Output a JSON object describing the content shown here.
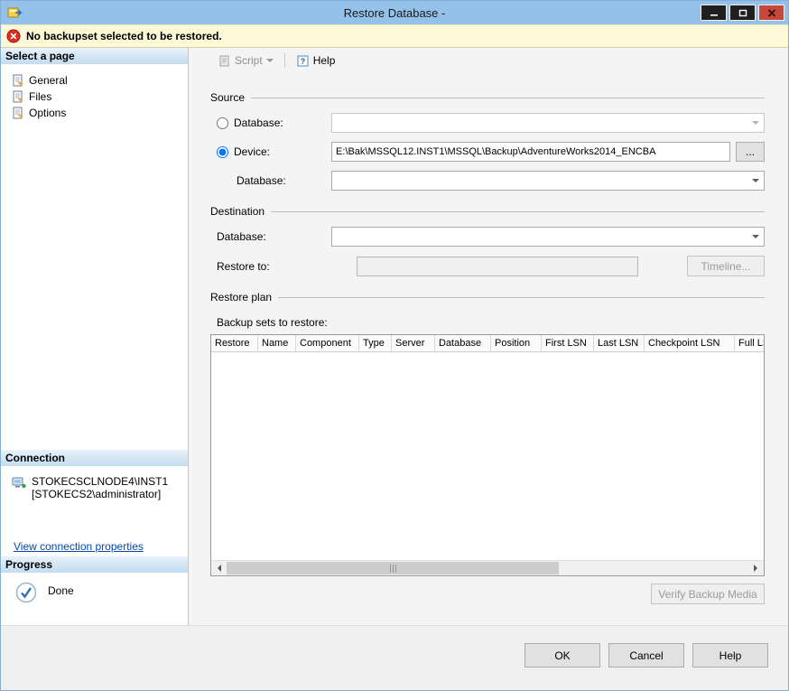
{
  "window": {
    "title": "Restore Database -"
  },
  "warning": {
    "message": "No backupset selected to be restored."
  },
  "sidebar": {
    "select_page": {
      "header": "Select a page",
      "items": [
        {
          "label": "General"
        },
        {
          "label": "Files"
        },
        {
          "label": "Options"
        }
      ]
    },
    "connection": {
      "header": "Connection",
      "server": "STOKECSCLNODE4\\INST1",
      "account": "[STOKECS2\\administrator]",
      "link": "View connection properties"
    },
    "progress": {
      "header": "Progress",
      "status": "Done"
    }
  },
  "toolbar": {
    "script": "Script",
    "help": "Help"
  },
  "source": {
    "title": "Source",
    "database_label": "Database:",
    "device_label": "Device:",
    "device_path": "E:\\Bak\\MSSQL12.INST1\\MSSQL\\Backup\\AdventureWorks2014_ENCBA",
    "browse": "...",
    "database2_label": "Database:"
  },
  "destination": {
    "title": "Destination",
    "database_label": "Database:",
    "restore_to_label": "Restore to:",
    "timeline": "Timeline..."
  },
  "restore_plan": {
    "title": "Restore plan",
    "backup_sets_label": "Backup sets to restore:",
    "columns": [
      "Restore",
      "Name",
      "Component",
      "Type",
      "Server",
      "Database",
      "Position",
      "First LSN",
      "Last LSN",
      "Checkpoint LSN",
      "Full LS"
    ],
    "verify": "Verify Backup Media"
  },
  "footer": {
    "ok": "OK",
    "cancel": "Cancel",
    "help": "Help"
  }
}
